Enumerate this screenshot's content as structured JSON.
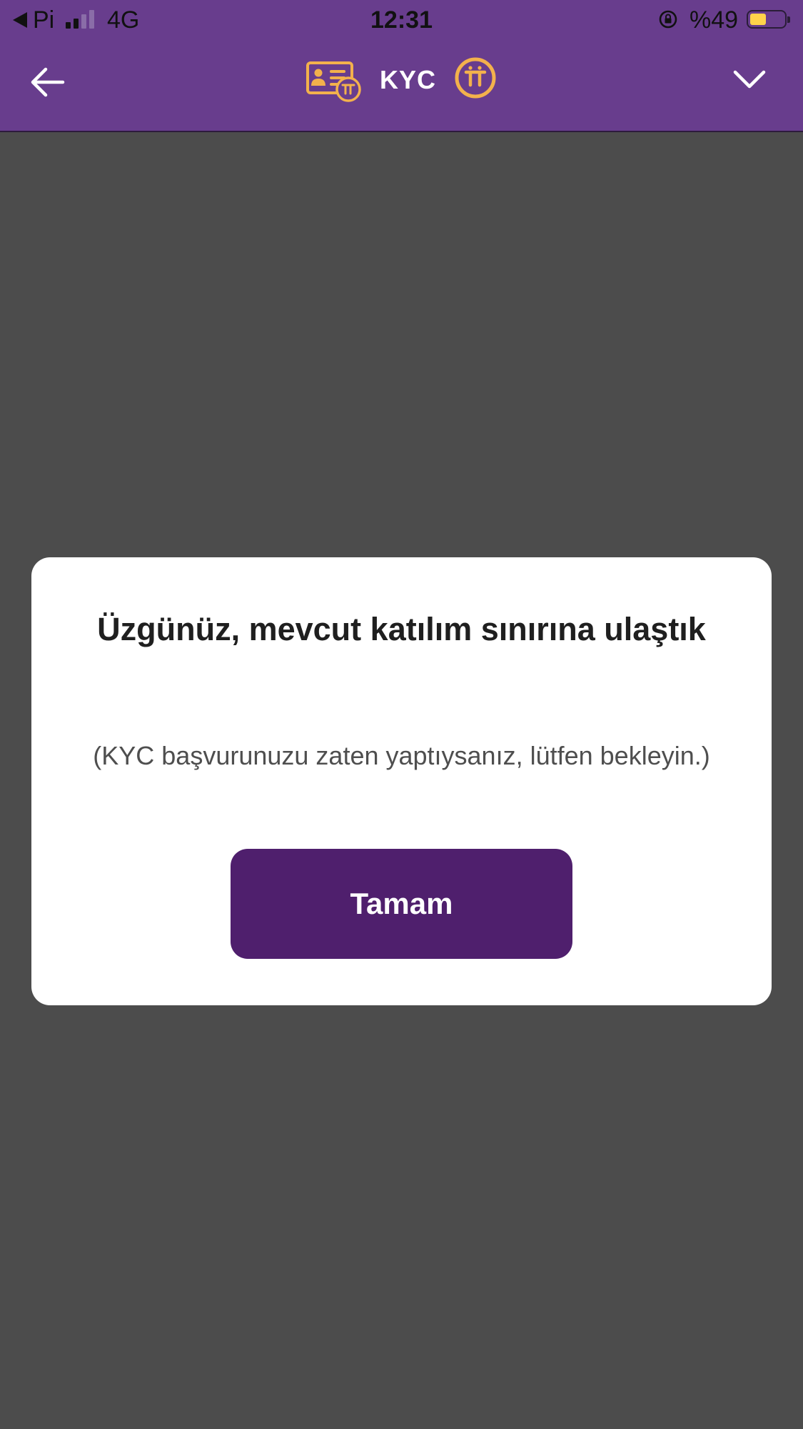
{
  "status_bar": {
    "back_app": "Pi",
    "network": "4G",
    "time": "12:31",
    "battery": "%49",
    "battery_level": 0.49,
    "signal_bars_active": 2,
    "signal_bars_total": 4
  },
  "header": {
    "title": "KYC",
    "left_icon": "arrow-left-icon",
    "card_icon": "id-card-icon",
    "logo_icon": "pi-logo-icon",
    "right_icon": "chevron-down-icon"
  },
  "dialog": {
    "title": "Üzgünüz, mevcut katılım sınırına ulaştık",
    "message": "(KYC başvurunuzu zaten yaptıysanız, lütfen bekleyin.)",
    "button_label": "Tamam"
  },
  "colors": {
    "header_bg": "#683d8d",
    "backdrop": "#4c4c4c",
    "accent_gold": "#f3b14c",
    "button_bg": "#4f1f6d"
  }
}
